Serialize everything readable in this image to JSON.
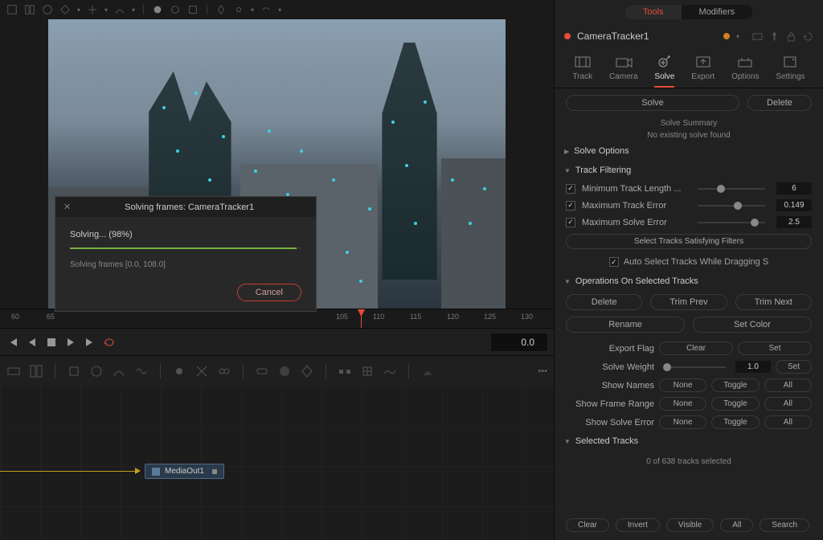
{
  "panel_tabs": {
    "tools": "Tools",
    "modifiers": "Modifiers"
  },
  "node_name": "CameraTracker1",
  "categories": {
    "track": "Track",
    "camera": "Camera",
    "solve": "Solve",
    "export": "Export",
    "options": "Options",
    "settings": "Settings"
  },
  "solve_actions": {
    "solve": "Solve",
    "delete": "Delete"
  },
  "summary": {
    "title": "Solve Summary",
    "status": "No existing solve found"
  },
  "sections": {
    "solve_options": "Solve Options",
    "track_filtering": "Track Filtering",
    "operations": "Operations On Selected Tracks",
    "selected_tracks": "Selected Tracks"
  },
  "filters": {
    "min_length": {
      "label": "Minimum Track Length ...",
      "value": "6"
    },
    "max_track_err": {
      "label": "Maximum Track Error",
      "value": "0.149"
    },
    "max_solve_err": {
      "label": "Maximum Solve Error",
      "value": "2.5"
    },
    "satisfy_btn": "Select Tracks Satisfying Filters",
    "auto_select": "Auto Select Tracks While Dragging S"
  },
  "ops": {
    "delete": "Delete",
    "trim_prev": "Trim Prev",
    "trim_next": "Trim Next",
    "rename": "Rename",
    "set_color": "Set Color",
    "export_flag": "Export Flag",
    "clear": "Clear",
    "set": "Set",
    "solve_weight": "Solve Weight",
    "weight_val": "1.0",
    "show_names": "Show Names",
    "show_frame": "Show Frame Range",
    "show_solve_err": "Show Solve Error",
    "none": "None",
    "toggle": "Toggle",
    "all": "All"
  },
  "selected_status": "0 of 638 tracks selected",
  "bottom": {
    "clear": "Clear",
    "invert": "Invert",
    "visible": "Visible",
    "all": "All",
    "search": "Search"
  },
  "modal": {
    "title": "Solving frames: CameraTracker1",
    "status": "Solving... (98%)",
    "sub": "Solving frames [0.0, 108.0]",
    "cancel": "Cancel"
  },
  "transport": {
    "frame": "0.0"
  },
  "ruler": [
    "60",
    "65",
    "105",
    "110",
    "115",
    "120",
    "125",
    "130"
  ],
  "node_out": "MediaOut1"
}
